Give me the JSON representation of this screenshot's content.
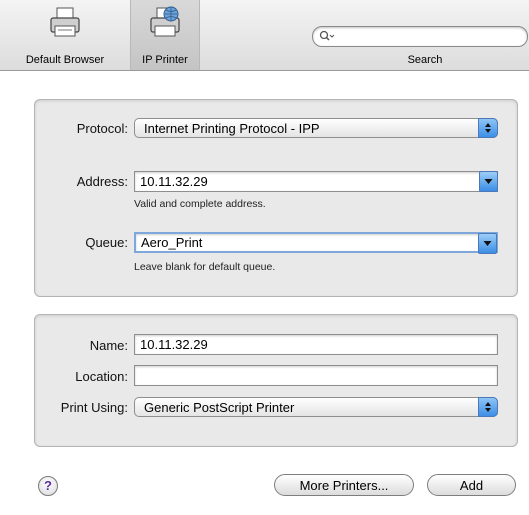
{
  "toolbar": {
    "default_browser_label": "Default Browser",
    "ip_printer_label": "IP Printer",
    "search_label": "Search",
    "search_placeholder": ""
  },
  "connection": {
    "protocol_label": "Protocol:",
    "protocol_value": "Internet Printing Protocol - IPP",
    "address_label": "Address:",
    "address_value": "10.11.32.29",
    "address_hint": "Valid and complete address.",
    "queue_label": "Queue:",
    "queue_value": "Aero_Print",
    "queue_hint": "Leave blank for default queue."
  },
  "printer": {
    "name_label": "Name:",
    "name_value": "10.11.32.29",
    "location_label": "Location:",
    "location_value": "",
    "print_using_label": "Print Using:",
    "print_using_value": "Generic PostScript Printer"
  },
  "footer": {
    "help_label": "?",
    "more_printers_label": "More Printers...",
    "add_label": "Add"
  }
}
